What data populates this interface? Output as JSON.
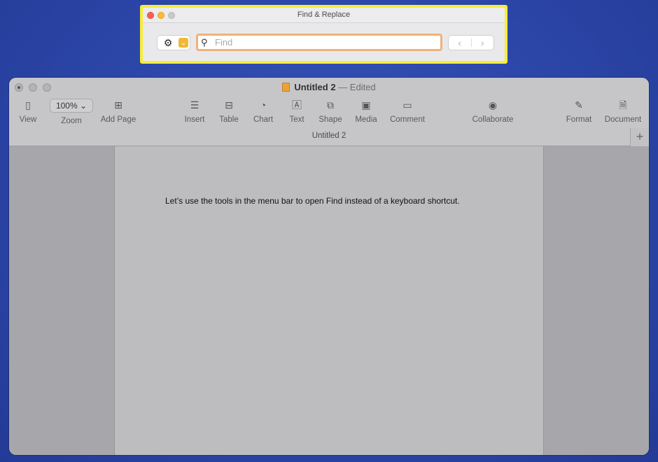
{
  "find_window": {
    "title": "Find & Replace",
    "gear_icon": "⚙",
    "dropdown_icon": "⌄",
    "search_icon": "⚲",
    "find_placeholder": "Find",
    "find_value": "",
    "prev_icon": "‹",
    "next_icon": "›"
  },
  "main_window": {
    "doc_name": "Untitled 2",
    "doc_status": "— Edited",
    "tab_label": "Untitled 2",
    "tab_add_icon": "+",
    "toolbar": {
      "view": "View",
      "zoom_value": "100% ⌄",
      "zoom": "Zoom",
      "add_page": "Add Page",
      "insert": "Insert",
      "table": "Table",
      "chart": "Chart",
      "text": "Text",
      "shape": "Shape",
      "media": "Media",
      "comment": "Comment",
      "collaborate": "Collaborate",
      "format": "Format",
      "document": "Document"
    },
    "page_text": "Let’s use the tools in the menu bar to open Find instead of a keyboard shortcut."
  }
}
